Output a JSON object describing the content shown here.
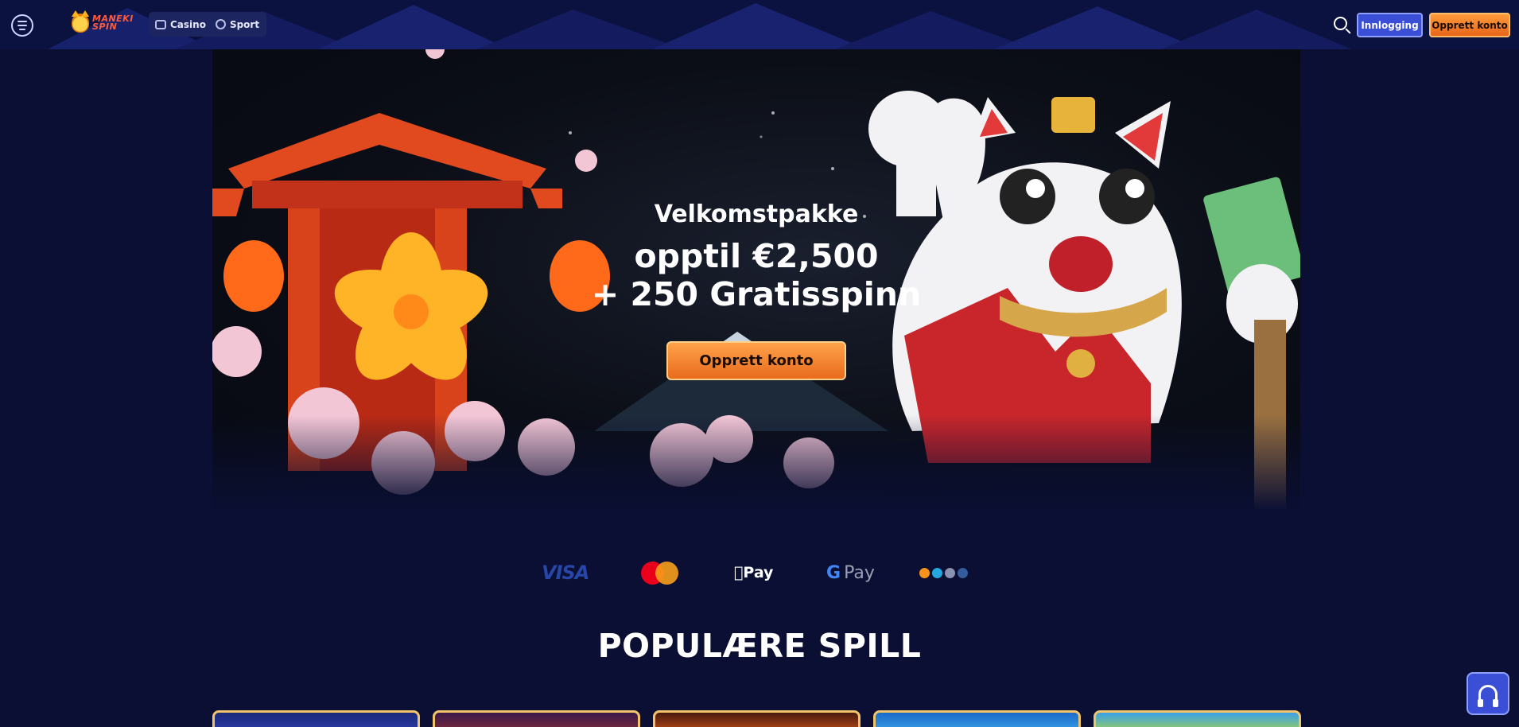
{
  "header": {
    "logo_text_line1": "Maneki",
    "logo_text_line2": "Spin",
    "nav": [
      {
        "label": "Casino",
        "icon": "cards-icon"
      },
      {
        "label": "Sport",
        "icon": "football-icon"
      }
    ],
    "login_label": "Innlogging",
    "register_label": "Opprett konto"
  },
  "hero": {
    "subtitle": "Velkomstpakke",
    "line1": "opptil €2,500",
    "line2": "+ 250 Gratisspinn",
    "cta_label": "Opprett konto"
  },
  "payments": {
    "visa": "VISA",
    "applepay": "Pay",
    "gpay_g": "G",
    "gpay_text": "Pay"
  },
  "section": {
    "title": "POPULÆRE SPILL"
  },
  "colors": {
    "background": "#0a0f33",
    "accent_blue": "#3b4ed6",
    "accent_orange": "#e86b1c"
  }
}
